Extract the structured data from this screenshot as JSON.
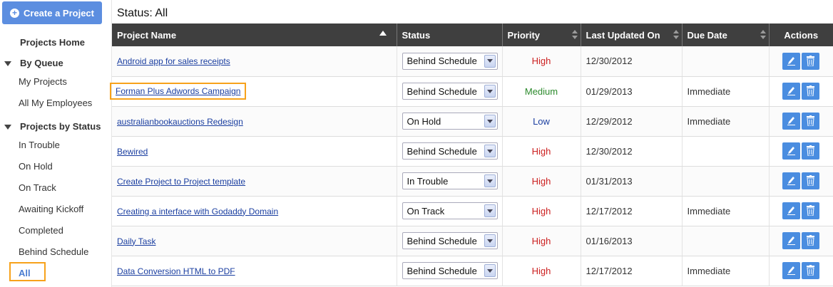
{
  "sidebar": {
    "create_label": "Create a Project",
    "projects_home": "Projects Home",
    "by_queue": "By Queue",
    "queue_items": [
      "My Projects",
      "All My Employees"
    ],
    "by_status": "Projects by Status",
    "status_items": [
      "In Trouble",
      "On Hold",
      "On Track",
      "Awaiting Kickoff",
      "Completed",
      "Behind Schedule",
      "All"
    ]
  },
  "main": {
    "title": "Status: All",
    "columns": [
      "Project Name",
      "Status",
      "Priority",
      "Last Updated On",
      "Due Date",
      "Actions"
    ],
    "rows": [
      {
        "name": "Android app for sales receipts",
        "status": "Behind Schedule",
        "priority": "High",
        "updated": "12/30/2012",
        "due": ""
      },
      {
        "name": "Forman Plus Adwords Campaign",
        "status": "Behind Schedule",
        "priority": "Medium",
        "updated": "01/29/2013",
        "due": "Immediate"
      },
      {
        "name": "australianbookauctions Redesign",
        "status": "On Hold",
        "priority": "Low",
        "updated": "12/29/2012",
        "due": "Immediate"
      },
      {
        "name": "Bewired",
        "status": "Behind Schedule",
        "priority": "High",
        "updated": "12/30/2012",
        "due": ""
      },
      {
        "name": "Create Project to Project template",
        "status": "In Trouble",
        "priority": "High",
        "updated": "01/31/2013",
        "due": ""
      },
      {
        "name": "Creating a interface with Godaddy Domain",
        "status": "On Track",
        "priority": "High",
        "updated": "12/17/2012",
        "due": "Immediate"
      },
      {
        "name": "Daily Task",
        "status": "Behind Schedule",
        "priority": "High",
        "updated": "01/16/2013",
        "due": ""
      },
      {
        "name": "Data Conversion HTML to PDF",
        "status": "Behind Schedule",
        "priority": "High",
        "updated": "12/17/2012",
        "due": "Immediate"
      }
    ]
  },
  "colors": {
    "high": "#cc1f1f",
    "medium": "#2c8a2c",
    "low": "#1a3ea0",
    "accent": "#5c8ee0",
    "highlight": "#f7a21b"
  }
}
